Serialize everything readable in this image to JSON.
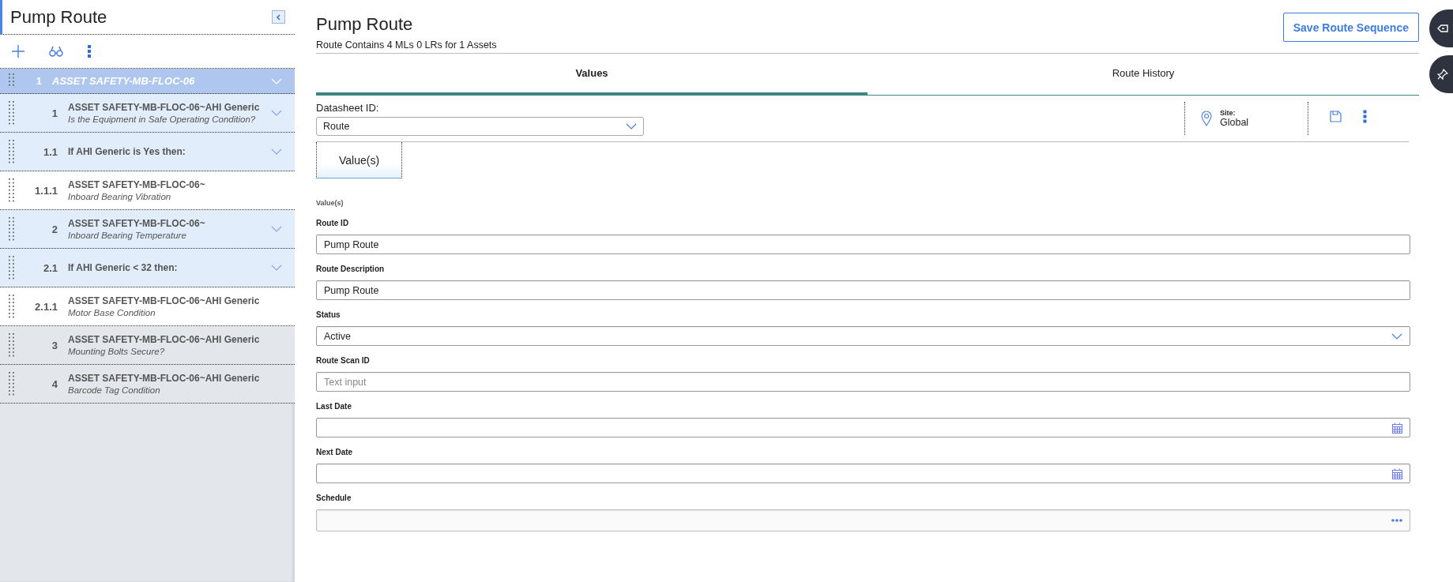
{
  "sidebar": {
    "title": "Pump Route",
    "tree": [
      {
        "number": "1",
        "title": "ASSET SAFETY-MB-FLOC-06",
        "kind": "asset",
        "selected": true,
        "expanded": true,
        "children": [
          {
            "number": "1",
            "title": "ASSET SAFETY-MB-FLOC-06~AHI Generic",
            "subtitle": "Is the Equipment in Safe Operating Condition?",
            "kind": "question",
            "selected": false,
            "expanded": true,
            "children": [
              {
                "number": "1.1",
                "title": "If AHI Generic is Yes then:",
                "kind": "condition",
                "selected": false,
                "expanded": true,
                "children": [
                  {
                    "number": "1.1.1",
                    "title": "ASSET SAFETY-MB-FLOC-06~",
                    "subtitle": "Inboard Bearing Vibration",
                    "kind": "question",
                    "selected": false
                  }
                ]
              }
            ]
          },
          {
            "number": "2",
            "title": "ASSET SAFETY-MB-FLOC-06~",
            "subtitle": "Inboard Bearing Temperature",
            "kind": "question",
            "selected": false,
            "expanded": true,
            "children": [
              {
                "number": "2.1",
                "title": "If AHI Generic < 32 then:",
                "kind": "condition",
                "selected": false,
                "expanded": true,
                "children": [
                  {
                    "number": "2.1.1",
                    "title": "ASSET SAFETY-MB-FLOC-06~AHI Generic",
                    "subtitle": "Motor Base Condition",
                    "kind": "question",
                    "selected": false
                  }
                ]
              }
            ]
          },
          {
            "number": "3",
            "title": "ASSET SAFETY-MB-FLOC-06~AHI Generic",
            "subtitle": "Mounting Bolts Secure?",
            "kind": "question",
            "selected": false
          },
          {
            "number": "4",
            "title": "ASSET SAFETY-MB-FLOC-06~AHI Generic",
            "subtitle": "Barcode Tag Condition",
            "kind": "question",
            "selected": false
          }
        ]
      }
    ]
  },
  "header": {
    "title": "Pump Route",
    "subtitle": "Route Contains 4 MLs 0 LRs for 1 Assets",
    "button": "Save Route Sequence"
  },
  "tabs": [
    {
      "label": "Values",
      "selected": true
    },
    {
      "label": "Route History",
      "selected": false
    }
  ],
  "datasheet": {
    "label": "Datasheet ID:",
    "value": "Route",
    "site_label": "Site:",
    "site": "Global"
  },
  "subtabs": [
    {
      "label": "Value(s)",
      "selected": true
    }
  ],
  "section_title": "Value(s)",
  "fields": [
    {
      "label": "Route ID",
      "kind": "text",
      "value": "Pump Route"
    },
    {
      "label": "Route Description",
      "kind": "text",
      "value": "Pump Route"
    },
    {
      "label": "Status",
      "kind": "select",
      "value": "Active"
    },
    {
      "label": "Route Scan ID",
      "kind": "text",
      "placeholder": "Text input"
    },
    {
      "label": "Last Date",
      "kind": "date"
    },
    {
      "label": "Next Date",
      "kind": "date"
    },
    {
      "label": "Schedule",
      "kind": "lookup"
    }
  ]
}
